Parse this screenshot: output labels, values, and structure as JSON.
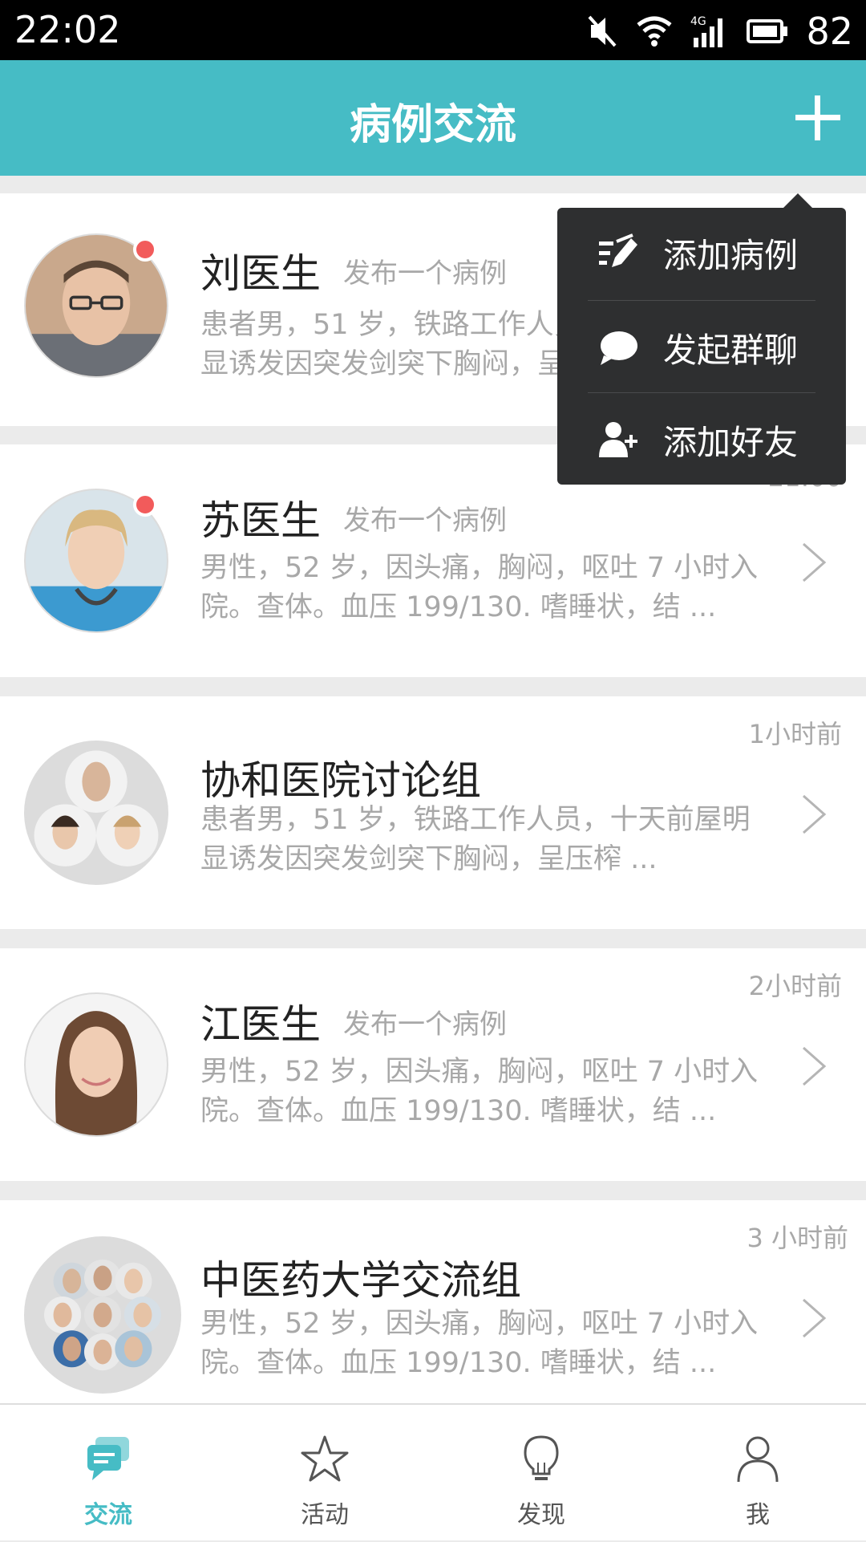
{
  "status_bar": {
    "time": "22:02",
    "battery": "82",
    "network": "4G"
  },
  "app_bar": {
    "title": "病例交流",
    "add_icon": "plus-icon"
  },
  "dropdown": {
    "items": [
      {
        "label": "添加病例",
        "icon": "edit-icon"
      },
      {
        "label": "发起群聊",
        "icon": "chat-bubble-icon"
      },
      {
        "label": "添加好友",
        "icon": "add-user-icon"
      }
    ]
  },
  "conversations": [
    {
      "name": "刘医生",
      "action": "发布一个病例",
      "time": "",
      "snippet": "患者男，51 岁，铁路工作人员，十天前屋明显诱发因突发剑突下胸闷，呈压榨 ...",
      "unread": true
    },
    {
      "name": "苏医生",
      "action": "发布一个病例",
      "time": "21:00",
      "snippet": "男性，52 岁，因头痛，胸闷，呕吐 7 小时入院。查体。血压 199/130. 嗜睡状，结 ...",
      "unread": true
    },
    {
      "name": "协和医院讨论组",
      "action": "",
      "time": "1小时前",
      "snippet": "患者男，51 岁，铁路工作人员，十天前屋明显诱发因突发剑突下胸闷，呈压榨 ...",
      "unread": false
    },
    {
      "name": "江医生",
      "action": "发布一个病例",
      "time": "2小时前",
      "snippet": "男性，52 岁，因头痛，胸闷，呕吐 7 小时入院。查体。血压 199/130. 嗜睡状，结 ...",
      "unread": false
    },
    {
      "name": "中医药大学交流组",
      "action": "",
      "time": "3 小时前",
      "snippet": "男性，52 岁，因头痛，胸闷，呕吐 7 小时入院。查体。血压 199/130. 嗜睡状，结 ...",
      "unread": false
    }
  ],
  "tabs": [
    {
      "label": "交流",
      "icon": "chat-icon",
      "active": true
    },
    {
      "label": "活动",
      "icon": "star-icon",
      "active": false
    },
    {
      "label": "发现",
      "icon": "lightbulb-icon",
      "active": false
    },
    {
      "label": "我",
      "icon": "user-icon",
      "active": false
    }
  ],
  "colors": {
    "accent": "#46bcc5",
    "unread": "#f25b5b",
    "menu_bg": "#2e2f30"
  }
}
